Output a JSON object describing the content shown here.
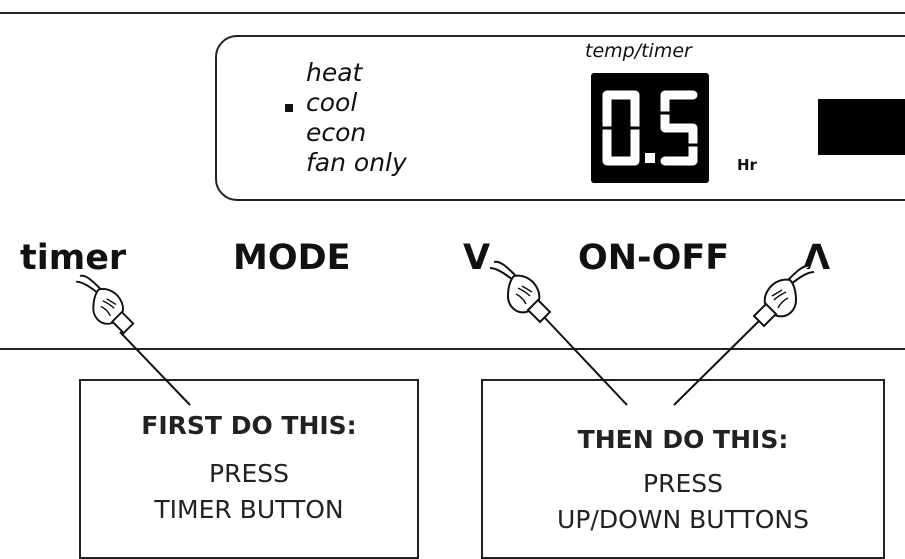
{
  "display": {
    "modes": [
      "heat",
      "cool",
      "econ",
      "fan only"
    ],
    "selected_mode": "cool",
    "temp_timer_label": "temp/timer",
    "value": "0.5",
    "unit": "Hr"
  },
  "buttons": {
    "timer": "timer",
    "mode": "MODE",
    "down": "V",
    "on_off": "ON-OFF",
    "up": "Λ"
  },
  "callouts": {
    "first": {
      "heading": "FIRST DO THIS:",
      "line1": "PRESS",
      "line2": "TIMER BUTTON"
    },
    "then": {
      "heading": "THEN DO THIS:",
      "line1": "PRESS",
      "line2": "UP/DOWN BUTTONS"
    }
  },
  "icons": [
    "pointing-hand-icon",
    "mode-indicator-square-icon"
  ],
  "colors": {
    "ink": "#111111",
    "lcd_background": "#000000",
    "lcd_segments": "#ffffff"
  }
}
